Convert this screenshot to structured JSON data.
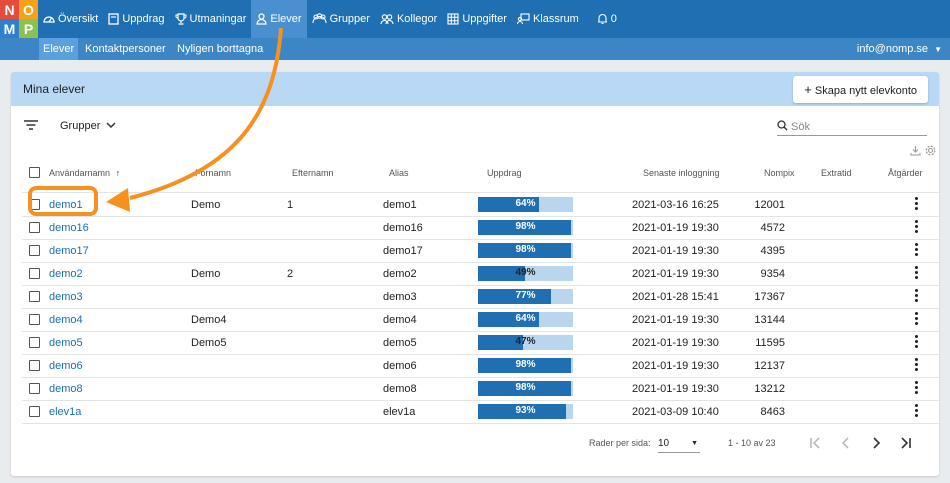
{
  "logo": {
    "letters": [
      "N",
      "O",
      "M",
      "P"
    ],
    "colors": [
      "#e64c3c",
      "#f6a11a",
      "#2e7fd0",
      "#8cc152"
    ]
  },
  "nav": {
    "items": [
      {
        "label": "Översikt",
        "icon": "dashboard-icon"
      },
      {
        "label": "Uppdrag",
        "icon": "book-icon"
      },
      {
        "label": "Utmaningar",
        "icon": "trophy-icon"
      },
      {
        "label": "Elever",
        "icon": "user-icon",
        "active": true
      },
      {
        "label": "Grupper",
        "icon": "users-icon"
      },
      {
        "label": "Kollegor",
        "icon": "colleagues-icon"
      },
      {
        "label": "Uppgifter",
        "icon": "grid-icon"
      },
      {
        "label": "Klassrum",
        "icon": "classroom-icon"
      },
      {
        "label": "0",
        "icon": "bell-icon"
      }
    ]
  },
  "subnav": {
    "items": [
      "Elever",
      "Kontaktpersoner",
      "Nyligen borttagna"
    ],
    "account": "info@nomp.se"
  },
  "card": {
    "title": "Mina elever",
    "create_label": "Skapa nytt elevkonto"
  },
  "toolbar": {
    "groups_label": "Grupper",
    "search_placeholder": "Sök"
  },
  "table": {
    "headers": [
      "Användarnamn",
      "Förnamn",
      "Efternamn",
      "Alias",
      "Uppdrag",
      "Senaste inloggning",
      "Nompix",
      "Extratid",
      "Åtgärder"
    ],
    "rows": [
      {
        "username": "demo1",
        "first": "Demo",
        "last": "1",
        "alias": "demo1",
        "progress": 64,
        "progress_label": "64%",
        "login": "2021-03-16 16:25",
        "nompix": "12001"
      },
      {
        "username": "demo16",
        "first": "",
        "last": "",
        "alias": "demo16",
        "progress": 98,
        "progress_label": "98%",
        "login": "2021-01-19 19:30",
        "nompix": "4572"
      },
      {
        "username": "demo17",
        "first": "",
        "last": "",
        "alias": "demo17",
        "progress": 98,
        "progress_label": "98%",
        "login": "2021-01-19 19:30",
        "nompix": "4395"
      },
      {
        "username": "demo2",
        "first": "Demo",
        "last": "2",
        "alias": "demo2",
        "progress": 49,
        "progress_label": "49%",
        "login": "2021-01-19 19:30",
        "nompix": "9354"
      },
      {
        "username": "demo3",
        "first": "",
        "last": "",
        "alias": "demo3",
        "progress": 77,
        "progress_label": "77%",
        "login": "2021-01-28 15:41",
        "nompix": "17367"
      },
      {
        "username": "demo4",
        "first": "Demo4",
        "last": "",
        "alias": "demo4",
        "progress": 64,
        "progress_label": "64%",
        "login": "2021-01-19 19:30",
        "nompix": "13144"
      },
      {
        "username": "demo5",
        "first": "Demo5",
        "last": "",
        "alias": "demo5",
        "progress": 47,
        "progress_label": "47%",
        "login": "2021-01-19 19:30",
        "nompix": "11595"
      },
      {
        "username": "demo6",
        "first": "",
        "last": "",
        "alias": "demo6",
        "progress": 98,
        "progress_label": "98%",
        "login": "2021-01-19 19:30",
        "nompix": "12137"
      },
      {
        "username": "demo8",
        "first": "",
        "last": "",
        "alias": "demo8",
        "progress": 98,
        "progress_label": "98%",
        "login": "2021-01-19 19:30",
        "nompix": "13212"
      },
      {
        "username": "elev1a",
        "first": "",
        "last": "",
        "alias": "elev1a",
        "progress": 93,
        "progress_label": "93%",
        "login": "2021-03-09 10:40",
        "nompix": "8463"
      }
    ]
  },
  "pagination": {
    "rows_per_page_label": "Rader per sida:",
    "rows_per_page": "10",
    "range": "1 - 10 av 23"
  },
  "colors": {
    "primary": "#1f6fb2",
    "subnav": "#3d86c6",
    "card_header": "#b9d8f5",
    "highlight": "#f6901e",
    "link": "#1a6fb5"
  }
}
